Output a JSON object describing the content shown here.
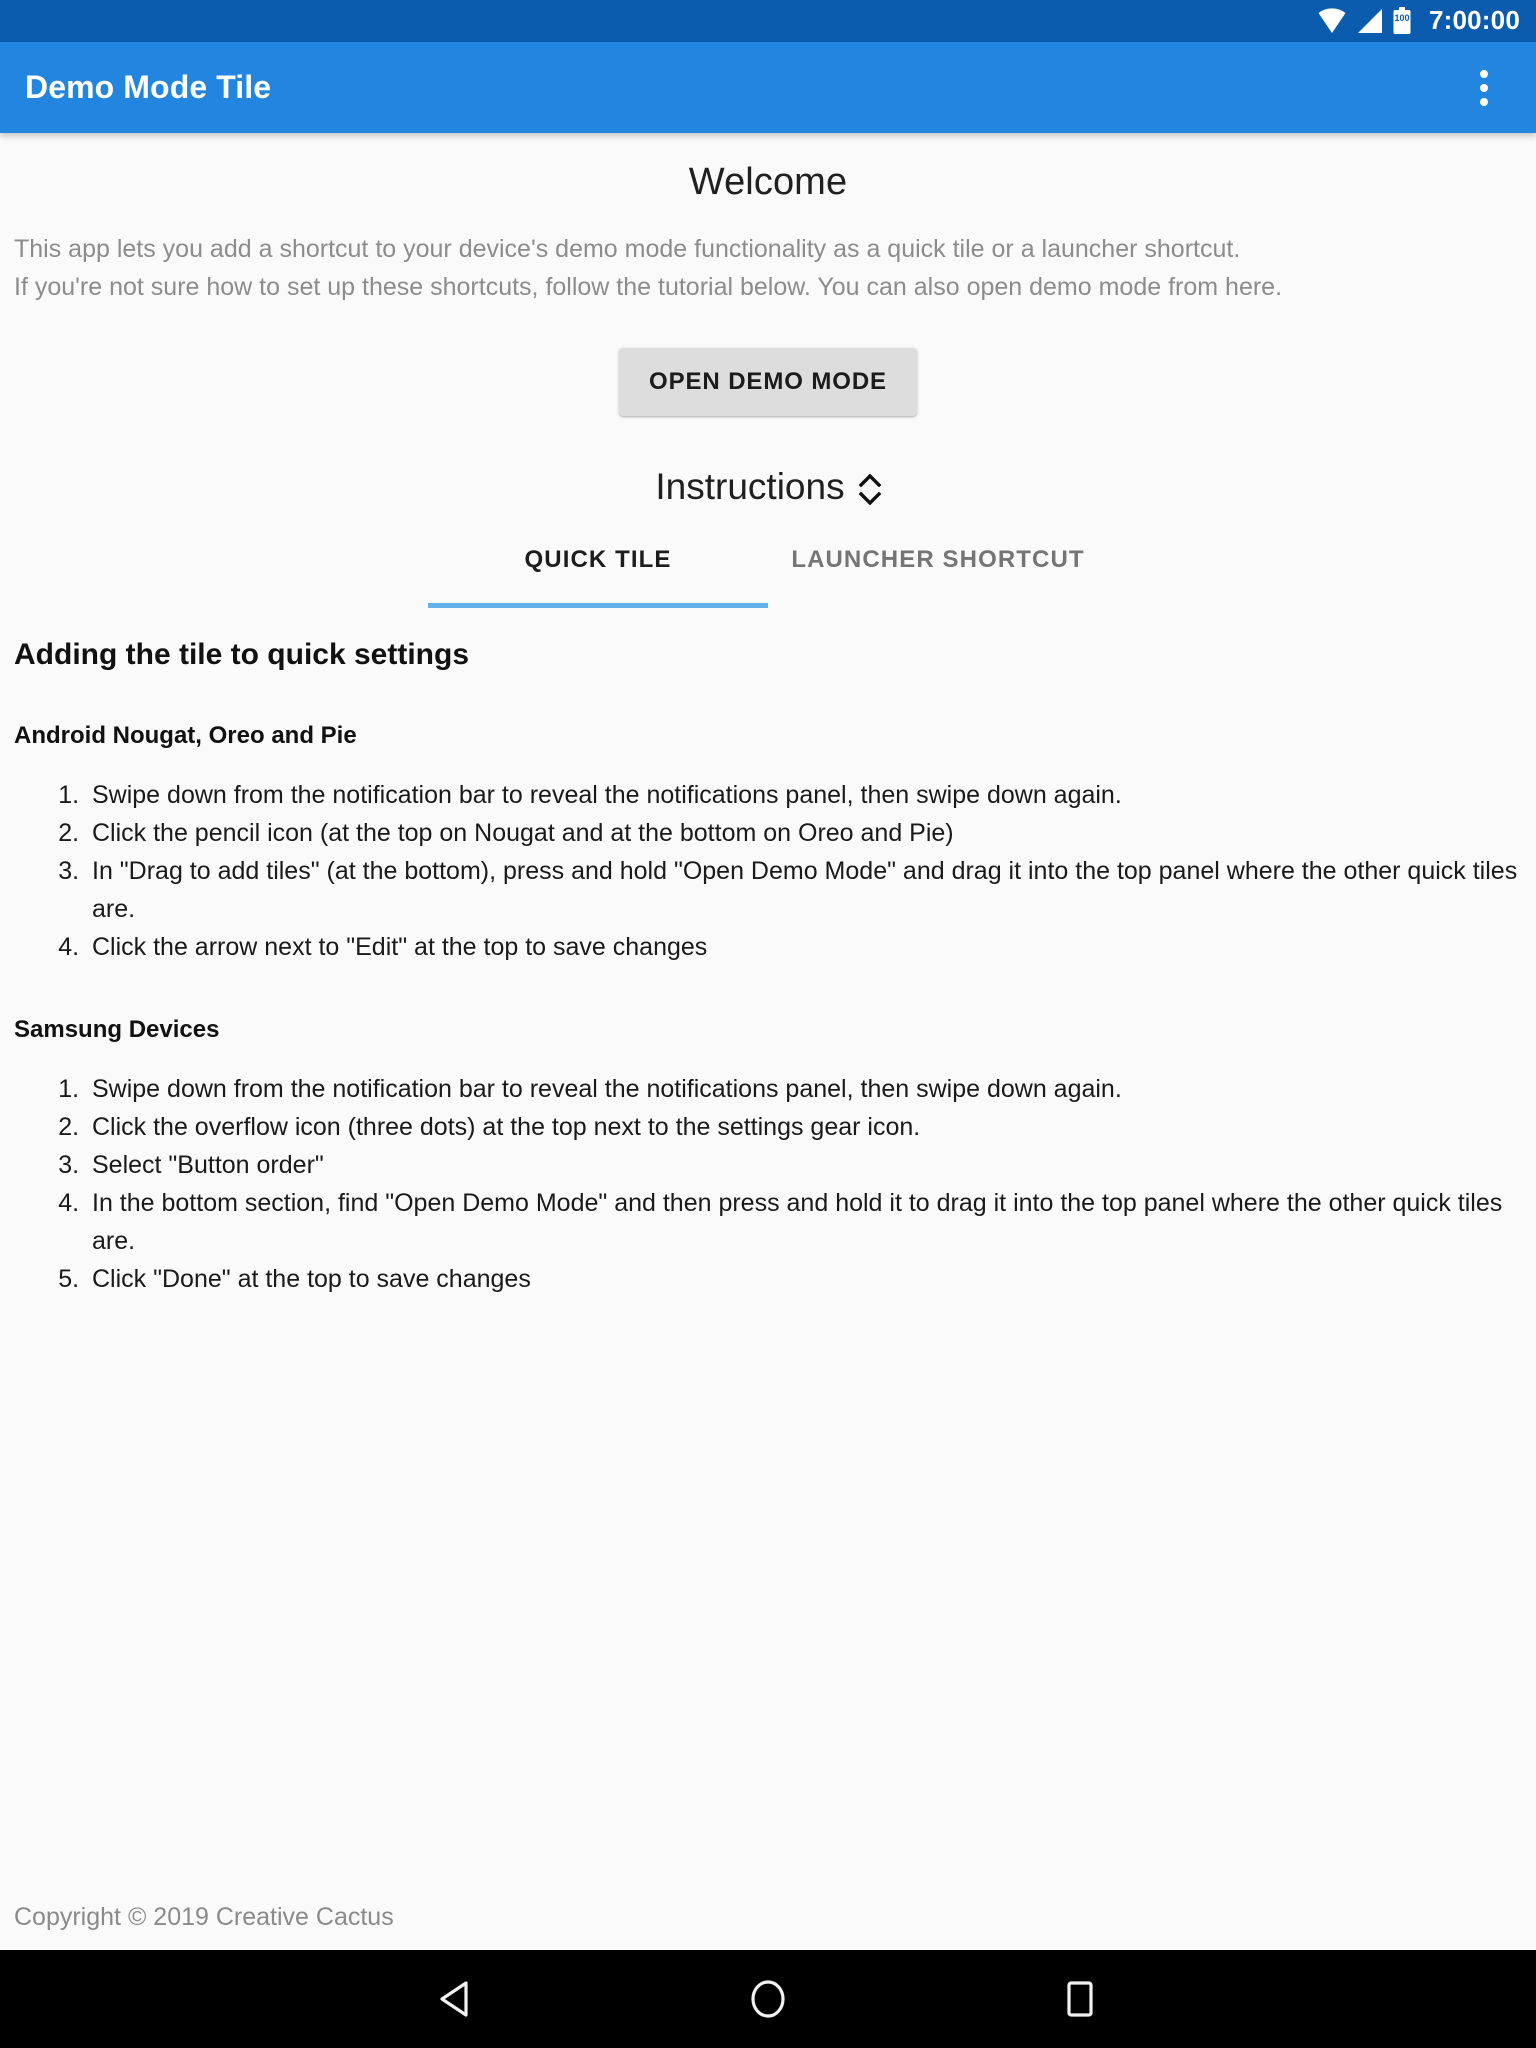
{
  "colors": {
    "status_bar": "#0b5cae",
    "app_bar": "#2286e0",
    "tab_indicator": "#64b0ea",
    "button_bg": "#dddddd",
    "page_bg": "#fafafa",
    "nav_bar": "#000000"
  },
  "status_bar": {
    "clock": "7:00:00",
    "battery_level": "100",
    "icons": [
      "wifi-icon",
      "cellular-signal-icon",
      "battery-icon"
    ]
  },
  "app_bar": {
    "title": "Demo Mode Tile",
    "overflow_icon": "overflow-menu-icon"
  },
  "welcome": {
    "title": "Welcome",
    "description": "This app lets you add a shortcut to your device's demo mode functionality as a quick tile or a launcher shortcut.\nIf you're not sure how to set up these shortcuts, follow the tutorial below. You can also open demo mode from here.",
    "open_demo_button": "OPEN DEMO MODE"
  },
  "instructions": {
    "title": "Instructions",
    "toggle_icon": "expand-collapse-chevron-icon",
    "tabs": [
      {
        "label": "QUICK TILE",
        "active": true
      },
      {
        "label": "LAUNCHER SHORTCUT",
        "active": false
      }
    ]
  },
  "tutorial": {
    "section_title": "Adding the tile to quick settings",
    "groups": [
      {
        "heading": "Android Nougat, Oreo and Pie",
        "steps": [
          "Swipe down from the notification bar to reveal the notifications panel, then swipe down again.",
          "Click the pencil icon (at the top on Nougat and at the bottom on Oreo and Pie)",
          "In \"Drag to add tiles\" (at the bottom), press and hold \"Open Demo Mode\" and drag it into the top panel where the other quick tiles are.",
          "Click the arrow next to \"Edit\" at the top to save changes"
        ]
      },
      {
        "heading": "Samsung Devices",
        "steps": [
          "Swipe down from the notification bar to reveal the notifications panel, then swipe down again.",
          "Click the overflow icon (three dots) at the top next to the settings gear icon.",
          "Select \"Button order\"",
          "In the bottom section, find \"Open Demo Mode\" and then press and hold it to drag it into the top panel where the other quick tiles are.",
          "Click \"Done\" at the top to save changes"
        ]
      }
    ]
  },
  "footer": {
    "copyright": "Copyright © 2019 Creative Cactus"
  },
  "nav_bar": {
    "buttons": [
      {
        "name": "back-button",
        "icon": "back-triangle-icon"
      },
      {
        "name": "home-button",
        "icon": "home-circle-icon"
      },
      {
        "name": "recents-button",
        "icon": "recents-square-icon"
      }
    ]
  }
}
